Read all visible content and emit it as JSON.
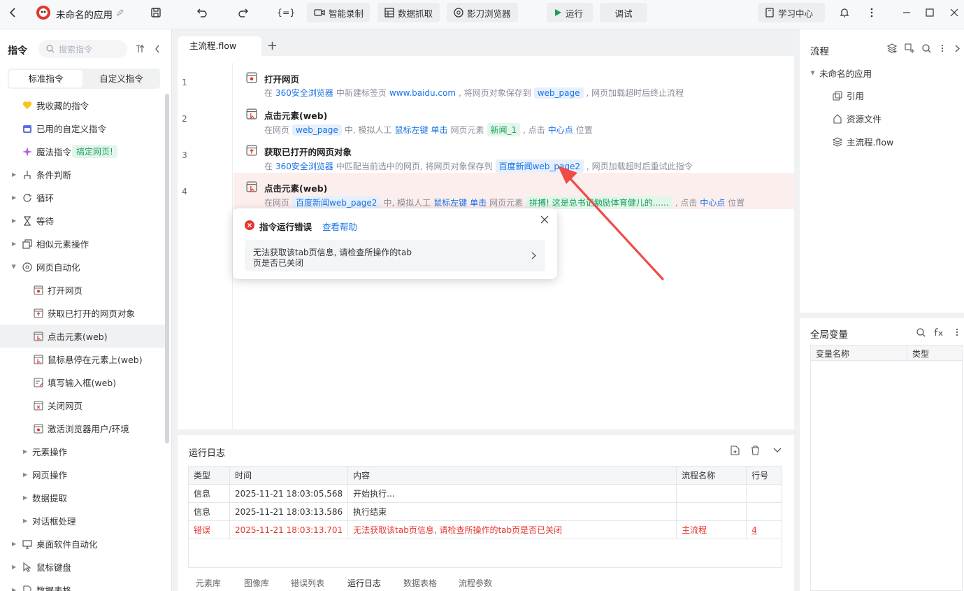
{
  "toolbar": {
    "app_name": "未命名的应用",
    "var_btn": "{=}",
    "smart_record": "智能录制",
    "data_capture": "数据抓取",
    "browser": "影刀浏览器",
    "run": "运行",
    "debug": "调试",
    "learn": "学习中心"
  },
  "left": {
    "title": "指令",
    "search_placeholder": "搜索指令",
    "tab_standard": "标准指令",
    "tab_custom": "自定义指令",
    "items": [
      {
        "label": "我收藏的指令"
      },
      {
        "label": "已用的自定义指令"
      },
      {
        "label": "魔法指令",
        "badge": "搞定网页!"
      },
      {
        "label": "条件判断"
      },
      {
        "label": "循环"
      },
      {
        "label": "等待"
      },
      {
        "label": "相似元素操作"
      },
      {
        "label": "网页自动化"
      },
      {
        "label": "打开网页"
      },
      {
        "label": "获取已打开的网页对象"
      },
      {
        "label": "点击元素(web)"
      },
      {
        "label": "鼠标悬停在元素上(web)"
      },
      {
        "label": "填写输入框(web)"
      },
      {
        "label": "关闭网页"
      },
      {
        "label": "激活浏览器用户/环境"
      },
      {
        "label": "元素操作"
      },
      {
        "label": "网页操作"
      },
      {
        "label": "数据提取"
      },
      {
        "label": "对话框处理"
      },
      {
        "label": "桌面软件自动化"
      },
      {
        "label": "鼠标键盘"
      },
      {
        "label": "数据表格"
      }
    ]
  },
  "editor": {
    "tab": "主流程.flow",
    "add_tab": "+",
    "steps": [
      {
        "num": "1",
        "title": "打开网页",
        "p1": "在",
        "browser": "360安全浏览器",
        "p2": "中新建标签页",
        "url": "www.baidu.com",
        "p3": ", 将网页对象保存到",
        "var": "web_page",
        "p4": ", 网页加载超时后终止流程"
      },
      {
        "num": "2",
        "title": "点击元素(web)",
        "p1": "在网页",
        "var": "web_page",
        "p2": "中, 模拟人工",
        "mouse": "鼠标左键",
        "click": "单击",
        "p3": "网页元素",
        "elem": "新闻_1",
        "p4": ", 点击",
        "pos": "中心点",
        "p5": "位置"
      },
      {
        "num": "3",
        "title": "获取已打开的网页对象",
        "p1": "在",
        "browser": "360安全浏览器",
        "p2": "中匹配当前选中的网页, 将网页对象保存到",
        "var": "百度新闻web_page2",
        "p3": ", 网页加载超时后重试此指令"
      },
      {
        "num": "4",
        "title": "点击元素(web)",
        "p1": "在网页",
        "var": "百度新闻web_page2",
        "p2": "中, 模拟人工",
        "mouse": "鼠标左键",
        "click": "单击",
        "p3": "网页元素",
        "elem": "拼搏! 这是总书记勉励体育健儿的......",
        "p4": ", 点击",
        "pos": "中心点",
        "p5": "位置"
      }
    ]
  },
  "popup": {
    "title": "指令运行错误",
    "help": "查看帮助",
    "message_line1": "无法获取该tab页信息, 请检查所操作的tab",
    "message_line2": "页是否已关闭"
  },
  "log": {
    "title": "运行日志",
    "headers": [
      "类型",
      "时间",
      "内容",
      "流程名称",
      "行号"
    ],
    "rows": [
      {
        "type": "信息",
        "time": "2025-11-21 18:03:05.568",
        "content": "开始执行...",
        "flow": "",
        "line": ""
      },
      {
        "type": "信息",
        "time": "2025-11-21 18:03:13.586",
        "content": "执行结束",
        "flow": "",
        "line": ""
      },
      {
        "type": "错误",
        "time": "2025-11-21 18:03:13.701",
        "content": "无法获取该tab页信息, 请检查所操作的tab页是否已关闭",
        "flow": "主流程",
        "line": "4"
      }
    ],
    "bottom_tabs": [
      "元素库",
      "图像库",
      "错误列表",
      "运行日志",
      "数据表格",
      "流程参数"
    ]
  },
  "right": {
    "flow_title": "流程",
    "app_node": "未命名的应用",
    "ref": "引用",
    "resources": "资源文件",
    "main_flow": "主流程.flow",
    "global_vars": "全局变量",
    "col_name": "变量名称",
    "col_type": "类型"
  },
  "colors": {
    "accent": "#1a73e8",
    "error": "#e5352e",
    "green": "#18a058",
    "error_row_bg": "#fdeeee"
  }
}
